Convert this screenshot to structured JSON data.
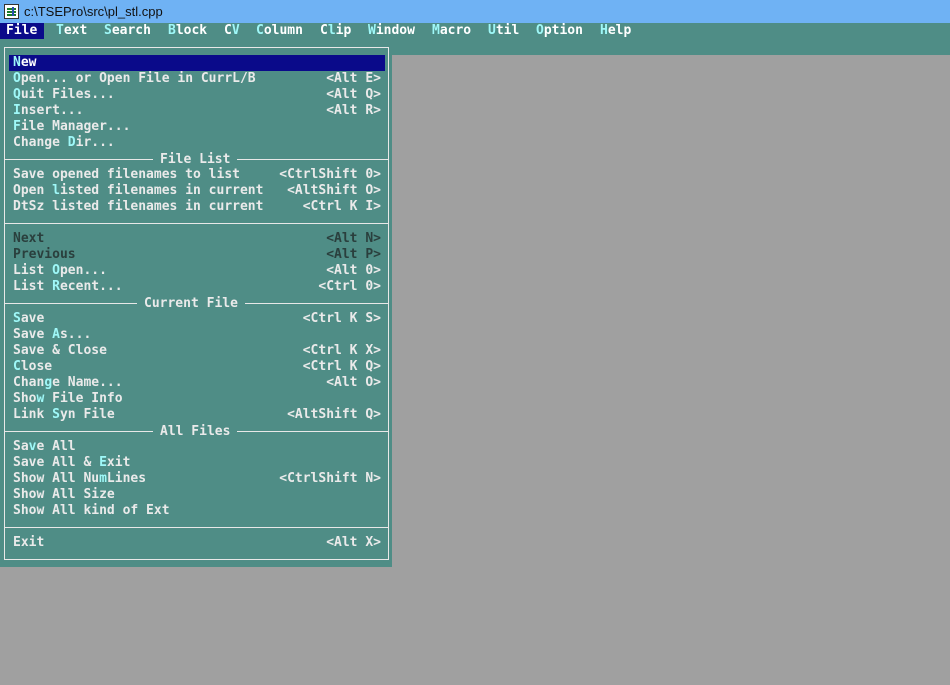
{
  "window": {
    "title": "c:\\TSEPro\\src\\pl_stl.cpp",
    "icon": "tse-app-icon"
  },
  "menubar": [
    {
      "hot": "F",
      "rest": "ile",
      "active": true
    },
    {
      "hot": "T",
      "rest": "ext"
    },
    {
      "hot": "S",
      "rest": "earch"
    },
    {
      "hot": "B",
      "rest": "lock"
    },
    {
      "pre": "C",
      "hot": "V",
      "rest": ""
    },
    {
      "hot": "C",
      "rest": "olumn"
    },
    {
      "pre": "C",
      "hot": "l",
      "rest": "ip"
    },
    {
      "hot": "W",
      "rest": "indow"
    },
    {
      "hot": "M",
      "rest": "acro"
    },
    {
      "hot": "U",
      "rest": "til"
    },
    {
      "hot": "O",
      "rest": "ption"
    },
    {
      "hot": "H",
      "rest": "elp"
    }
  ],
  "sections": {
    "file_list": "File List",
    "current_file": "Current File",
    "all_files": "All Files"
  },
  "items": [
    {
      "pre": "",
      "hot": "N",
      "rest": "ew",
      "shortcut": "",
      "selected": true
    },
    {
      "pre": "",
      "hot": "O",
      "rest": "pen... or Open File in CurrL/B",
      "shortcut": "<Alt E>"
    },
    {
      "pre": "",
      "hot": "Q",
      "rest": "uit Files...",
      "shortcut": "<Alt Q>"
    },
    {
      "pre": "",
      "hot": "I",
      "rest": "nsert...",
      "shortcut": "<Alt R>"
    },
    {
      "pre": "",
      "hot": "F",
      "rest": "ile Manager...",
      "shortcut": ""
    },
    {
      "pre": "Change ",
      "hot": "D",
      "rest": "ir...",
      "shortcut": ""
    },
    {
      "pre": "Save opened filenames to list",
      "hot": "",
      "rest": "",
      "shortcut": "<CtrlShift 0>"
    },
    {
      "pre": "Open ",
      "hot": "l",
      "rest": "isted filenames in current",
      "shortcut": "<AltShift O>"
    },
    {
      "pre": "DtSz listed filenames in current",
      "hot": "",
      "rest": "",
      "shortcut": "<Ctrl K I>"
    },
    {
      "pre": "",
      "hot": "N",
      "rest": "ext",
      "shortcut": "<Alt N>",
      "disabled": true
    },
    {
      "pre": "",
      "hot": "P",
      "rest": "revious",
      "shortcut": "<Alt P>",
      "disabled": true
    },
    {
      "pre": "List ",
      "hot": "O",
      "rest": "pen...",
      "shortcut": "<Alt 0>"
    },
    {
      "pre": "List ",
      "hot": "R",
      "rest": "ecent...",
      "shortcut": "<Ctrl 0>"
    },
    {
      "pre": "",
      "hot": "S",
      "rest": "ave",
      "shortcut": "<Ctrl K S>"
    },
    {
      "pre": "Save ",
      "hot": "A",
      "rest": "s...",
      "shortcut": ""
    },
    {
      "pre": "Save & Close",
      "hot": "",
      "rest": "",
      "shortcut": "<Ctrl K X>"
    },
    {
      "pre": "",
      "hot": "C",
      "rest": "lose",
      "shortcut": "<Ctrl K Q>"
    },
    {
      "pre": "Chan",
      "hot": "g",
      "rest": "e Name...",
      "shortcut": "<Alt O>"
    },
    {
      "pre": "Sho",
      "hot": "w",
      "rest": " File Info",
      "shortcut": ""
    },
    {
      "pre": "Link ",
      "hot": "S",
      "rest": "yn File",
      "shortcut": "<AltShift Q>"
    },
    {
      "pre": "Sa",
      "hot": "v",
      "rest": "e All",
      "shortcut": ""
    },
    {
      "pre": "Save All & ",
      "hot": "E",
      "rest": "xit",
      "shortcut": ""
    },
    {
      "pre": "Show All Nu",
      "hot": "m",
      "rest": "Lines",
      "shortcut": "<CtrlShift N>"
    },
    {
      "pre": "Show All Size",
      "hot": "",
      "rest": "",
      "shortcut": ""
    },
    {
      "pre": "Show All kind of Ext",
      "hot": "",
      "rest": "",
      "shortcut": ""
    },
    {
      "pre": "E",
      "hot": "x",
      "rest": "it",
      "shortcut": "<Alt X>"
    }
  ]
}
